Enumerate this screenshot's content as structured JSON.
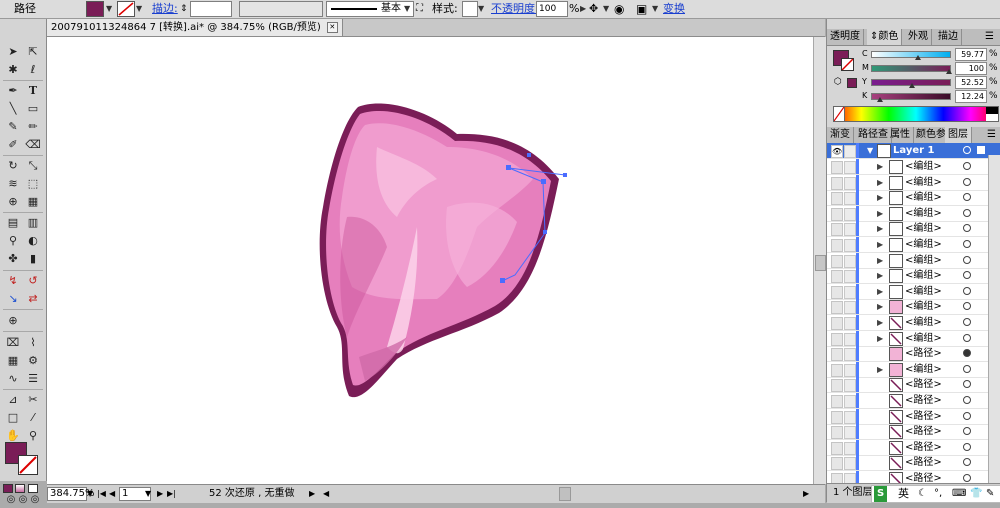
{
  "control_bar": {
    "object_type": "路径",
    "fill_color": "#7a1d57",
    "stroke_label": "描边:",
    "stroke_weight_value": "",
    "brush_label": "基本",
    "style_label": "样式:",
    "opacity_label": "不透明度:",
    "opacity_value": "100",
    "opacity_unit": "%",
    "transform_label": "变换"
  },
  "document_tab": {
    "title": "200791011324864 7 [转换].ai* @ 384.75% (RGB/预览)"
  },
  "status_bar": {
    "zoom": "384.75%",
    "artboard": "1",
    "message": "52 次还原 , 无重做"
  },
  "color_panel": {
    "tabs": [
      "透明度",
      "颜色",
      "外观",
      "描边"
    ],
    "active_tab": "颜色",
    "fill_swatch": "#7a1d57",
    "channels": [
      {
        "label": "C",
        "value": "59.77",
        "knob": 0.6,
        "gradient": "linear-gradient(to right,#ffffff,#00aeef)"
      },
      {
        "label": "M",
        "value": "100",
        "knob": 1.0,
        "gradient": "linear-gradient(to right,#2f9a77,#7a1d57)"
      },
      {
        "label": "Y",
        "value": "52.52",
        "knob": 0.53,
        "gradient": "linear-gradient(to right,#7a1d8f,#7a1d57)"
      },
      {
        "label": "K",
        "value": "12.24",
        "knob": 0.12,
        "gradient": "linear-gradient(to right,#a8417f,#3a0c28)"
      }
    ],
    "percent": "%"
  },
  "layers_panel": {
    "tabs": [
      "渐变",
      "路径查",
      "属性",
      "颜色参",
      "图层"
    ],
    "active_tab": "图层",
    "layer_name": "Layer 1",
    "items": [
      {
        "name": "<编组>",
        "arrow": "▶",
        "thumb": "blank"
      },
      {
        "name": "<编组>",
        "arrow": "▶",
        "thumb": "blank"
      },
      {
        "name": "<编组>",
        "arrow": "▶",
        "thumb": "blank"
      },
      {
        "name": "<编组>",
        "arrow": "▶",
        "thumb": "blank"
      },
      {
        "name": "<编组>",
        "arrow": "▶",
        "thumb": "blank"
      },
      {
        "name": "<编组>",
        "arrow": "▶",
        "thumb": "blank"
      },
      {
        "name": "<编组>",
        "arrow": "▶",
        "thumb": "blank"
      },
      {
        "name": "<编组>",
        "arrow": "▶",
        "thumb": "blank"
      },
      {
        "name": "<编组>",
        "arrow": "▶",
        "thumb": "blank"
      },
      {
        "name": "<编组>",
        "arrow": "▶",
        "thumb": "pink"
      },
      {
        "name": "<编组>",
        "arrow": "▶",
        "thumb": "diag"
      },
      {
        "name": "<编组>",
        "arrow": "▶",
        "thumb": "diag"
      },
      {
        "name": "<路径>",
        "arrow": "",
        "thumb": "pink",
        "target_filled": true
      },
      {
        "name": "<编组>",
        "arrow": "▶",
        "thumb": "pink"
      },
      {
        "name": "<路径>",
        "arrow": "",
        "thumb": "diag"
      },
      {
        "name": "<路径>",
        "arrow": "",
        "thumb": "diag"
      },
      {
        "name": "<路径>",
        "arrow": "",
        "thumb": "diag"
      },
      {
        "name": "<路径>",
        "arrow": "",
        "thumb": "diag"
      },
      {
        "name": "<路径>",
        "arrow": "",
        "thumb": "diag"
      },
      {
        "name": "<路径>",
        "arrow": "",
        "thumb": "diag"
      },
      {
        "name": "<路径>",
        "arrow": "",
        "thumb": "diag"
      },
      {
        "name": "<路径>",
        "arrow": "",
        "thumb": "diag"
      }
    ],
    "bottom_label": "1 个图层",
    "ime_label": "英"
  },
  "tools_colors": {
    "fill": "#7a1d57"
  }
}
